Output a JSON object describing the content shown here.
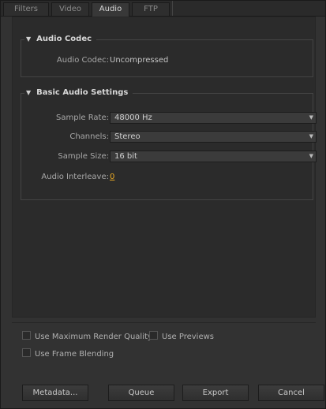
{
  "tabs": [
    {
      "label": "Filters"
    },
    {
      "label": "Video"
    },
    {
      "label": "Audio"
    },
    {
      "label": "FTP"
    }
  ],
  "active_tab": "Audio",
  "audio_codec_section": {
    "title": "Audio Codec",
    "codec_label": "Audio Codec:",
    "codec_value": "Uncompressed"
  },
  "basic_audio_section": {
    "title": "Basic Audio Settings",
    "sample_rate_label": "Sample Rate:",
    "sample_rate_value": "48000 Hz",
    "channels_label": "Channels:",
    "channels_value": "Stereo",
    "sample_size_label": "Sample Size:",
    "sample_size_value": "16 bit",
    "interleave_label": "Audio Interleave:",
    "interleave_value": "0"
  },
  "options": {
    "max_render_quality": "Use Maximum Render Quality",
    "use_previews": "Use Previews",
    "frame_blending": "Use Frame Blending"
  },
  "buttons": {
    "metadata": "Metadata...",
    "queue": "Queue",
    "export": "Export",
    "cancel": "Cancel"
  },
  "colors": {
    "background": "#323232",
    "link": "#e8a824"
  }
}
